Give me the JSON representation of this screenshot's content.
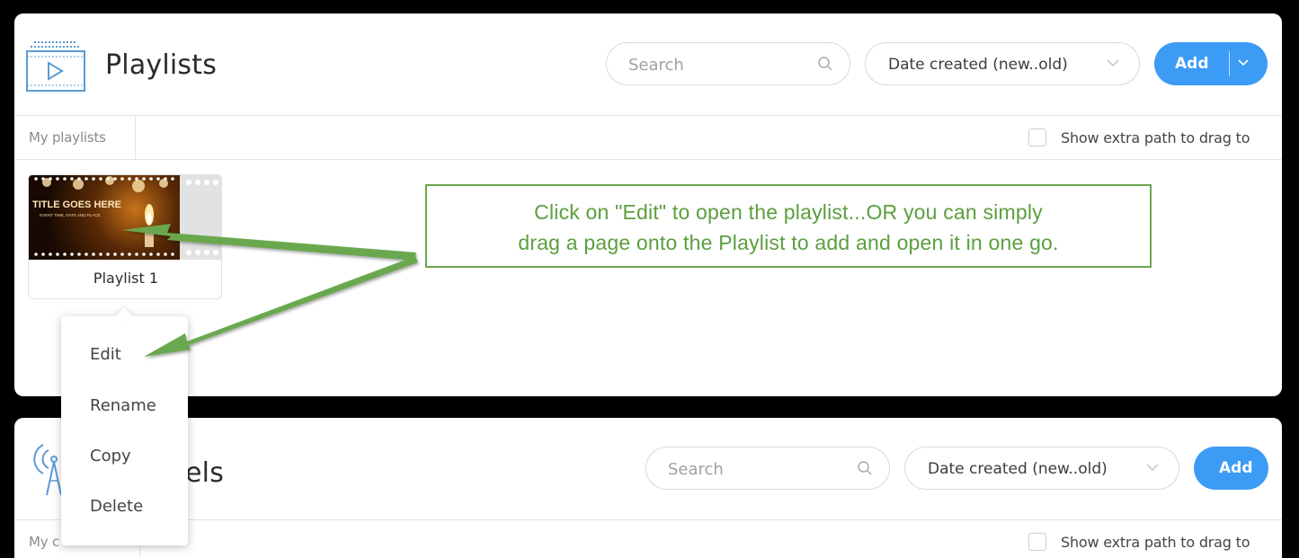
{
  "playlists": {
    "title": "Playlists",
    "icon": "playlist-play-icon",
    "search_placeholder": "Search",
    "sort_value": "Date created (new..old)",
    "add_label": "Add",
    "tab": "My playlists",
    "checkbox_label": "Show extra path to drag to",
    "cards": [
      {
        "title": "Playlist 1",
        "thumb_heading": "TITLE GOES HERE",
        "thumb_sub": "EVENT TIME, DATE AND PLACE"
      }
    ]
  },
  "context_menu": {
    "items": [
      "Edit",
      "Rename",
      "Copy",
      "Delete"
    ]
  },
  "channels": {
    "title_visible": "els",
    "icon": "broadcast-tower-icon",
    "search_placeholder": "Search",
    "sort_value": "Date created (new..old)",
    "add_label": "Add",
    "tab_visible": "My c",
    "checkbox_label": "Show extra path to drag to"
  },
  "callout": {
    "lines": [
      "Click on \"Edit\" to open the playlist...OR you can simply",
      "drag a page onto the Playlist to add and open it in one go."
    ]
  },
  "colors": {
    "accent": "#3c9bf5",
    "callout_green": "#6aa84f",
    "icon_blue": "#5b9bd5"
  }
}
